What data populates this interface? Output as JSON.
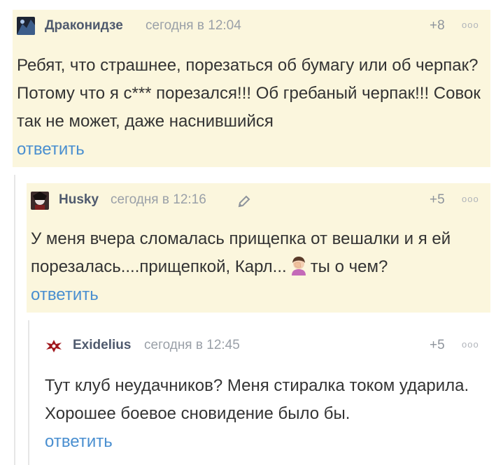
{
  "comments": [
    {
      "author": "Драконидзе",
      "time": "сегодня в 12:04",
      "rating": "+8",
      "text": "Ребят, что страшнее, порезаться об бумагу или об черпак? Потому что я с*** порезался!!! Об гребаный черпак!!! Совок так не может, даже наснившийся",
      "reply_label": "ответить",
      "more_label": "ooo"
    },
    {
      "author": "Husky",
      "time": "сегодня в 12:16",
      "rating": "+5",
      "text_before_emoji": "У меня вчера сломалась прищепка от вешалки и я ей порезалась....прищепкой, Карл...",
      "text_after_emoji": "ты о чем?",
      "reply_label": "ответить",
      "more_label": "ooo"
    },
    {
      "author": "Exidelius",
      "time": "сегодня в 12:45",
      "rating": "+5",
      "text": "Тут клуб неудачников? Меня стиралка током ударила. Хорошее боевое сновидение было бы.",
      "reply_label": "ответить",
      "more_label": "ooo"
    }
  ],
  "colors": {
    "highlight_bg": "#fbf6dd",
    "author": "#4f5a6e",
    "meta": "#9aa0a8",
    "link": "#4a8fd0"
  },
  "icons": {
    "edit": "pencil-icon",
    "emoji": "facepalm-emoji"
  }
}
